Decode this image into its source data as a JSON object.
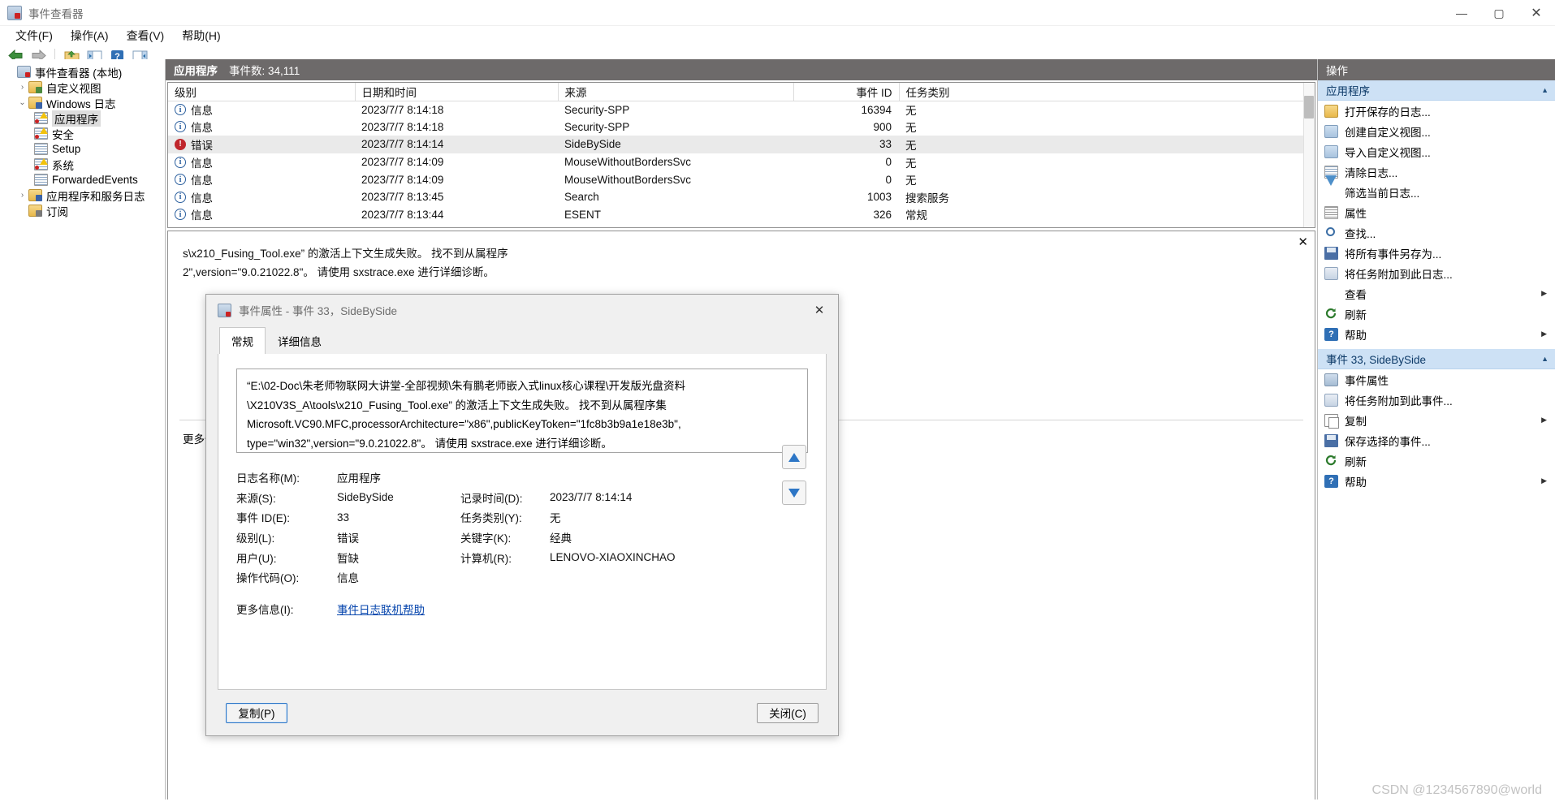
{
  "window": {
    "title": "事件查看器",
    "minimize": "—",
    "maximize": "▢",
    "close": "✕"
  },
  "menu": [
    {
      "label": "文件(F)"
    },
    {
      "label": "操作(A)"
    },
    {
      "label": "查看(V)"
    },
    {
      "label": "帮助(H)"
    }
  ],
  "toolbar": [
    {
      "name": "back",
      "glyph": "←"
    },
    {
      "name": "forward",
      "glyph": "→"
    },
    {
      "name": "open-folder",
      "glyph": "📂"
    },
    {
      "name": "show-pane-left",
      "glyph": "▤"
    },
    {
      "name": "help",
      "glyph": "?"
    },
    {
      "name": "show-pane-right",
      "glyph": "▥"
    }
  ],
  "tree": [
    {
      "label": "事件查看器 (本地)",
      "indent": 0,
      "twisty": "",
      "icon": "ic-evt",
      "selected": false
    },
    {
      "label": "自定义视图",
      "indent": 1,
      "twisty": "›",
      "icon": "ic-folder",
      "selected": false
    },
    {
      "label": "Windows 日志",
      "indent": 1,
      "twisty": "⌄",
      "icon": "ic-folderblue",
      "selected": false
    },
    {
      "label": "应用程序",
      "indent": 2,
      "twisty": "",
      "icon": "ic-logwarn",
      "selected": true
    },
    {
      "label": "安全",
      "indent": 2,
      "twisty": "",
      "icon": "ic-logwarn",
      "selected": false
    },
    {
      "label": "Setup",
      "indent": 2,
      "twisty": "",
      "icon": "ic-log",
      "selected": false
    },
    {
      "label": "系统",
      "indent": 2,
      "twisty": "",
      "icon": "ic-logwarn",
      "selected": false
    },
    {
      "label": "ForwardedEvents",
      "indent": 2,
      "twisty": "",
      "icon": "ic-log",
      "selected": false
    },
    {
      "label": "应用程序和服务日志",
      "indent": 1,
      "twisty": "›",
      "icon": "ic-folderblue",
      "selected": false
    },
    {
      "label": "订阅",
      "indent": 1,
      "twisty": "",
      "icon": "ic-sub",
      "selected": false
    }
  ],
  "list": {
    "group_title": "应用程序",
    "group_count": "事件数: 34,111",
    "columns": [
      "级别",
      "日期和时间",
      "来源",
      "事件 ID",
      "任务类别"
    ],
    "rows": [
      {
        "level": "信息",
        "level_icon": "info",
        "datetime": "2023/7/7 8:14:18",
        "source": "Security-SPP",
        "event_id": "16394",
        "category": "无",
        "selected": false
      },
      {
        "level": "信息",
        "level_icon": "info",
        "datetime": "2023/7/7 8:14:18",
        "source": "Security-SPP",
        "event_id": "900",
        "category": "无",
        "selected": false
      },
      {
        "level": "错误",
        "level_icon": "error",
        "datetime": "2023/7/7 8:14:14",
        "source": "SideBySide",
        "event_id": "33",
        "category": "无",
        "selected": true
      },
      {
        "level": "信息",
        "level_icon": "info",
        "datetime": "2023/7/7 8:14:09",
        "source": "MouseWithoutBordersSvc",
        "event_id": "0",
        "category": "无",
        "selected": false
      },
      {
        "level": "信息",
        "level_icon": "info",
        "datetime": "2023/7/7 8:14:09",
        "source": "MouseWithoutBordersSvc",
        "event_id": "0",
        "category": "无",
        "selected": false
      },
      {
        "level": "信息",
        "level_icon": "info",
        "datetime": "2023/7/7 8:13:45",
        "source": "Search",
        "event_id": "1003",
        "category": "搜索服务",
        "selected": false
      },
      {
        "level": "信息",
        "level_icon": "info",
        "datetime": "2023/7/7 8:13:44",
        "source": "ESENT",
        "event_id": "326",
        "category": "常规",
        "selected": false
      }
    ]
  },
  "detail": {
    "close_glyph": "✕",
    "msg_line1": "s\\x210_Fusing_Tool.exe” 的激活上下文生成失败。 找不到从属程序",
    "msg_line2": "2\",version=\"9.0.21022.8\"。 请使用 sxstrace.exe 进行详细诊断。",
    "more_label": "更多信息(I):",
    "more_link": "事件日志联机帮助"
  },
  "actions": {
    "title": "操作",
    "groups": [
      {
        "label": "应用程序",
        "caret": "▲",
        "items": [
          {
            "label": "打开保存的日志...",
            "icon": "aic-open",
            "submenu": false
          },
          {
            "label": "创建自定义视图...",
            "icon": "aic-view",
            "submenu": false
          },
          {
            "label": "导入自定义视图...",
            "icon": "aic-import",
            "submenu": false
          },
          {
            "label": "清除日志...",
            "icon": "aic-clear",
            "submenu": false
          },
          {
            "label": "筛选当前日志...",
            "icon": "aic-filter",
            "submenu": false
          },
          {
            "label": "属性",
            "icon": "aic-prop",
            "submenu": false
          },
          {
            "label": "查找...",
            "icon": "aic-find",
            "submenu": false
          },
          {
            "label": "将所有事件另存为...",
            "icon": "aic-save",
            "submenu": false
          },
          {
            "label": "将任务附加到此日志...",
            "icon": "aic-task",
            "submenu": false
          },
          {
            "label": "查看",
            "icon": "",
            "submenu": true
          },
          {
            "label": "刷新",
            "icon": "aic-refresh",
            "submenu": false
          },
          {
            "label": "帮助",
            "icon": "aic-help",
            "submenu": true
          }
        ]
      },
      {
        "label": "事件 33, SideBySide",
        "caret": "▲",
        "items": [
          {
            "label": "事件属性",
            "icon": "aic-evtprop",
            "submenu": false
          },
          {
            "label": "将任务附加到此事件...",
            "icon": "aic-task",
            "submenu": false
          },
          {
            "label": "复制",
            "icon": "aic-copy",
            "submenu": true
          },
          {
            "label": "保存选择的事件...",
            "icon": "aic-save",
            "submenu": false
          },
          {
            "label": "刷新",
            "icon": "aic-refresh",
            "submenu": false
          },
          {
            "label": "帮助",
            "icon": "aic-help",
            "submenu": true
          }
        ]
      }
    ]
  },
  "dialog": {
    "title": "事件属性 - 事件 33，SideBySide",
    "close_glyph": "✕",
    "tabs": [
      {
        "label": "常规",
        "active": true
      },
      {
        "label": "详细信息",
        "active": false
      }
    ],
    "message_lines": [
      "“E:\\02-Doc\\朱老师物联网大讲堂-全部视频\\朱有鹏老师嵌入式linux核心课程\\开发版光盘资料",
      "\\X210V3S_A\\tools\\x210_Fusing_Tool.exe” 的激活上下文生成失败。 找不到从属程序集",
      "Microsoft.VC90.MFC,processorArchitecture=\"x86\",publicKeyToken=\"1fc8b3b9a1e18e3b\",",
      "type=\"win32\",version=\"9.0.21022.8\"。 请使用 sxstrace.exe 进行详细诊断。"
    ],
    "fields": [
      {
        "label": "日志名称(M):",
        "value": "应用程序",
        "label2": "",
        "value2": ""
      },
      {
        "label": "来源(S):",
        "value": "SideBySide",
        "label2": "记录时间(D):",
        "value2": "2023/7/7 8:14:14"
      },
      {
        "label": "事件 ID(E):",
        "value": "33",
        "label2": "任务类别(Y):",
        "value2": "无"
      },
      {
        "label": "级别(L):",
        "value": "错误",
        "label2": "关键字(K):",
        "value2": "经典"
      },
      {
        "label": "用户(U):",
        "value": "暂缺",
        "label2": "计算机(R):",
        "value2": "LENOVO-XIAOXINCHAO"
      },
      {
        "label": "操作代码(O):",
        "value": "信息",
        "label2": "",
        "value2": ""
      }
    ],
    "more_label": "更多信息(I):",
    "more_link": "事件日志联机帮助",
    "nav_up": "▲",
    "nav_down": "▼",
    "copy_button": "复制(P)",
    "close_button": "关闭(C)"
  },
  "watermark": "CSDN @1234567890@world",
  "colors": {
    "group_header_bg": "#6d6a6a",
    "action_group_bg": "#cde1f5",
    "error_red": "#c0262c",
    "info_blue": "#2b5f9e",
    "link": "#0645ad"
  }
}
